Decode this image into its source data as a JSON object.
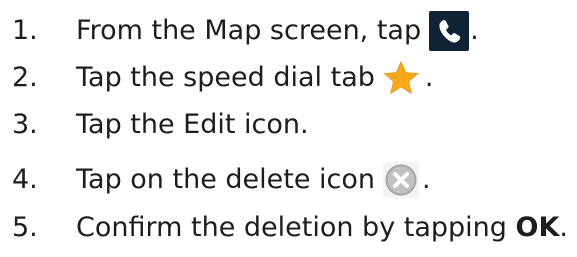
{
  "steps": [
    {
      "number": "1.",
      "text": "From the Map screen, tap",
      "after": ".",
      "icon": "phone-icon"
    },
    {
      "number": "2.",
      "text": "Tap the speed dial tab",
      "after": ".",
      "icon": "star-icon"
    },
    {
      "number": "3.",
      "text": "Tap the Edit icon."
    },
    {
      "number": "4.",
      "text": "Tap on the delete icon",
      "after": ".",
      "icon": "delete-icon"
    },
    {
      "number": "5.",
      "text": "Confirm the deletion by tapping ",
      "bold": "OK",
      "after": "."
    }
  ],
  "colors": {
    "text": "#1d1d1b",
    "phone_icon_bg": "#0e2336",
    "star": "#f7a81b",
    "delete_icon": "#b3b3b3"
  }
}
